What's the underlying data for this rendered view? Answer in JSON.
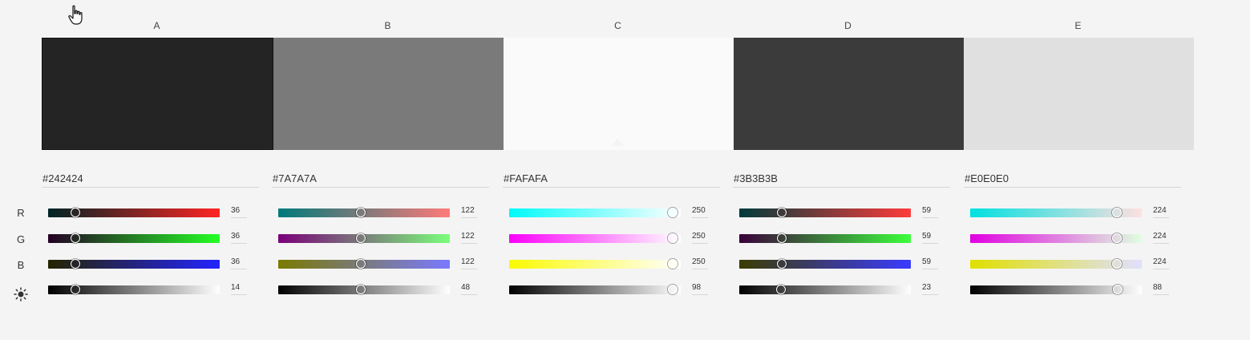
{
  "columns": [
    {
      "label": "A",
      "hex": "#242424",
      "color": "#242424",
      "selected": true,
      "sliders": [
        {
          "channel": "r",
          "value": "36",
          "fraction": 0.141,
          "gradient": [
            "#002424",
            "#ff2424"
          ]
        },
        {
          "channel": "g",
          "value": "36",
          "fraction": 0.141,
          "gradient": [
            "#240024",
            "#24ff24"
          ]
        },
        {
          "channel": "b",
          "value": "36",
          "fraction": 0.141,
          "gradient": [
            "#242400",
            "#2424ff"
          ]
        },
        {
          "channel": "brightness",
          "value": "14",
          "fraction": 0.14,
          "gradient": [
            "#000000",
            "#ffffff"
          ]
        }
      ]
    },
    {
      "label": "B",
      "hex": "#7A7A7A",
      "color": "#7A7A7A",
      "selected": false,
      "sliders": [
        {
          "channel": "r",
          "value": "122",
          "fraction": 0.478,
          "gradient": [
            "#007a7a",
            "#ff7a7a"
          ]
        },
        {
          "channel": "g",
          "value": "122",
          "fraction": 0.478,
          "gradient": [
            "#7a007a",
            "#7aff7a"
          ]
        },
        {
          "channel": "b",
          "value": "122",
          "fraction": 0.478,
          "gradient": [
            "#7a7a00",
            "#7a7aff"
          ]
        },
        {
          "channel": "brightness",
          "value": "48",
          "fraction": 0.478,
          "gradient": [
            "#000000",
            "#ffffff"
          ]
        }
      ]
    },
    {
      "label": "C",
      "hex": "#FAFAFA",
      "color": "#FAFAFA",
      "selected": false,
      "sliders": [
        {
          "channel": "r",
          "value": "250",
          "fraction": 0.98,
          "gradient": [
            "#00fafa",
            "#ffffff"
          ]
        },
        {
          "channel": "g",
          "value": "250",
          "fraction": 0.98,
          "gradient": [
            "#fa00fa",
            "#ffffff"
          ]
        },
        {
          "channel": "b",
          "value": "250",
          "fraction": 0.98,
          "gradient": [
            "#fafa00",
            "#ffffff"
          ]
        },
        {
          "channel": "brightness",
          "value": "98",
          "fraction": 0.98,
          "gradient": [
            "#000000",
            "#ffffff"
          ]
        }
      ]
    },
    {
      "label": "D",
      "hex": "#3B3B3B",
      "color": "#3B3B3B",
      "selected": false,
      "sliders": [
        {
          "channel": "r",
          "value": "59",
          "fraction": 0.231,
          "gradient": [
            "#003b3b",
            "#ff3b3b"
          ]
        },
        {
          "channel": "g",
          "value": "59",
          "fraction": 0.231,
          "gradient": [
            "#3b003b",
            "#3bff3b"
          ]
        },
        {
          "channel": "b",
          "value": "59",
          "fraction": 0.231,
          "gradient": [
            "#3b3b00",
            "#3b3bff"
          ]
        },
        {
          "channel": "brightness",
          "value": "23",
          "fraction": 0.23,
          "gradient": [
            "#000000",
            "#ffffff"
          ]
        }
      ]
    },
    {
      "label": "E",
      "hex": "#E0E0E0",
      "color": "#E0E0E0",
      "selected": false,
      "sliders": [
        {
          "channel": "r",
          "value": "224",
          "fraction": 0.878,
          "gradient": [
            "#00e0e0",
            "#ffe0e0"
          ]
        },
        {
          "channel": "g",
          "value": "224",
          "fraction": 0.878,
          "gradient": [
            "#e000e0",
            "#e0ffe0"
          ]
        },
        {
          "channel": "b",
          "value": "224",
          "fraction": 0.878,
          "gradient": [
            "#e0e000",
            "#e0e0ff"
          ]
        },
        {
          "channel": "brightness",
          "value": "88",
          "fraction": 0.88,
          "gradient": [
            "#000000",
            "#ffffff"
          ]
        }
      ]
    }
  ],
  "row_labels": {
    "r": "R",
    "g": "G",
    "b": "B",
    "brightness_icon": "sun-icon"
  },
  "cursor_icon": "hand-pointer-icon"
}
